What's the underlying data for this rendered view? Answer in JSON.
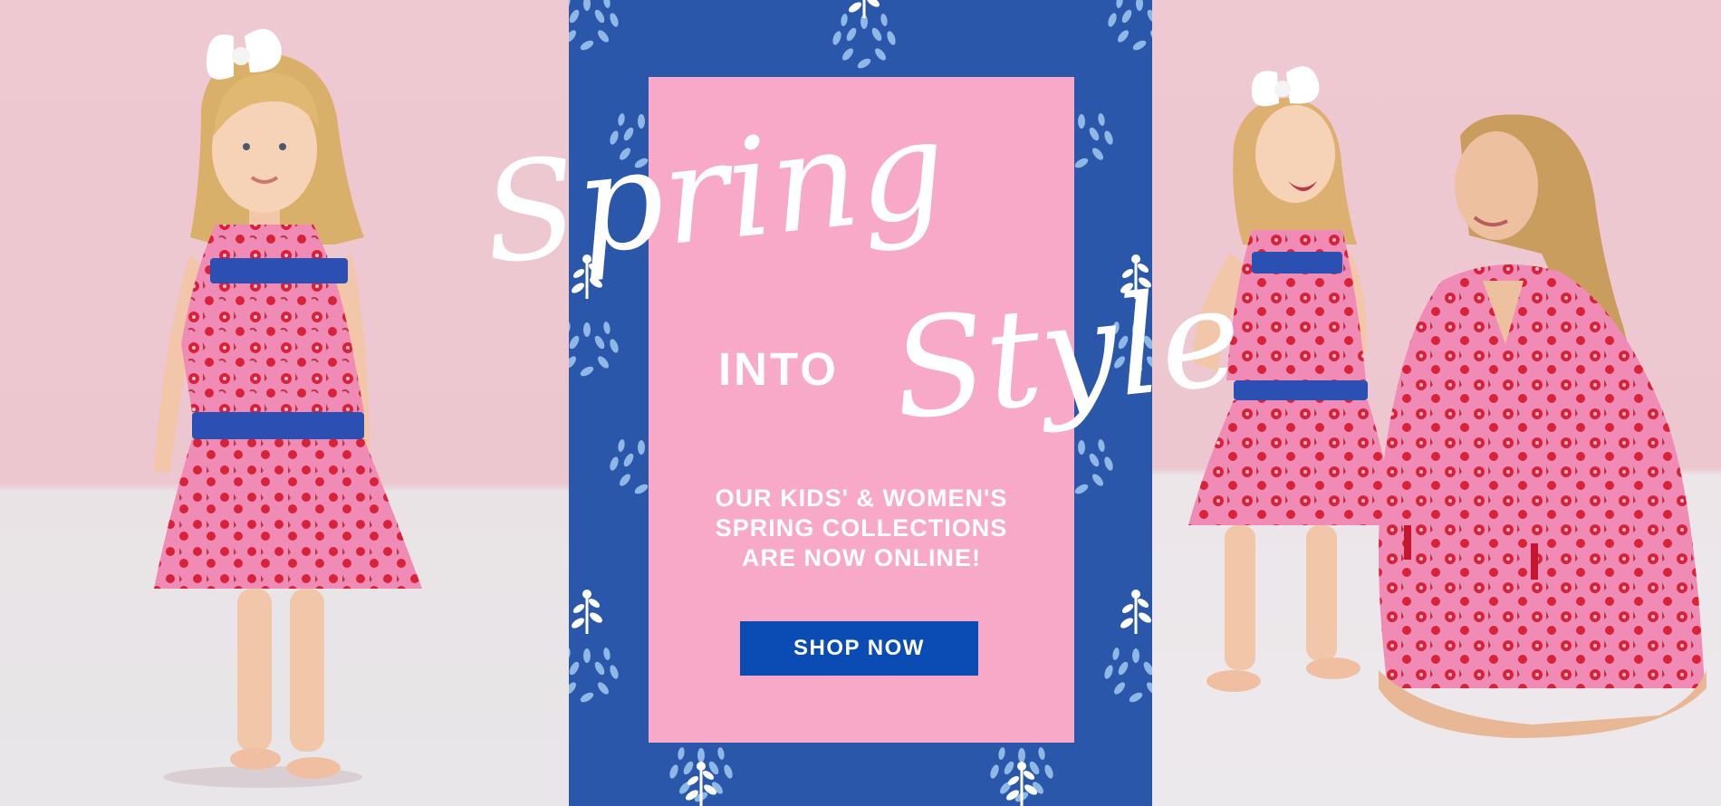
{
  "banner": {
    "headline_script_1": "Spring",
    "headline_word": "INTO",
    "headline_script_2": "Style",
    "tagline_lines": [
      "OUR KIDS' & WOMEN'S",
      "SPRING COLLECTIONS",
      "ARE NOW ONLINE!"
    ],
    "cta_label": "SHOP NOW"
  },
  "colors": {
    "panel_blue": "#2a57a9",
    "card_pink": "#f7a9c7",
    "button_blue": "#0a4bb4",
    "dress_pink": "#f08bb6",
    "print_red": "#d8223a",
    "trim_blue": "#2b4fb3"
  }
}
